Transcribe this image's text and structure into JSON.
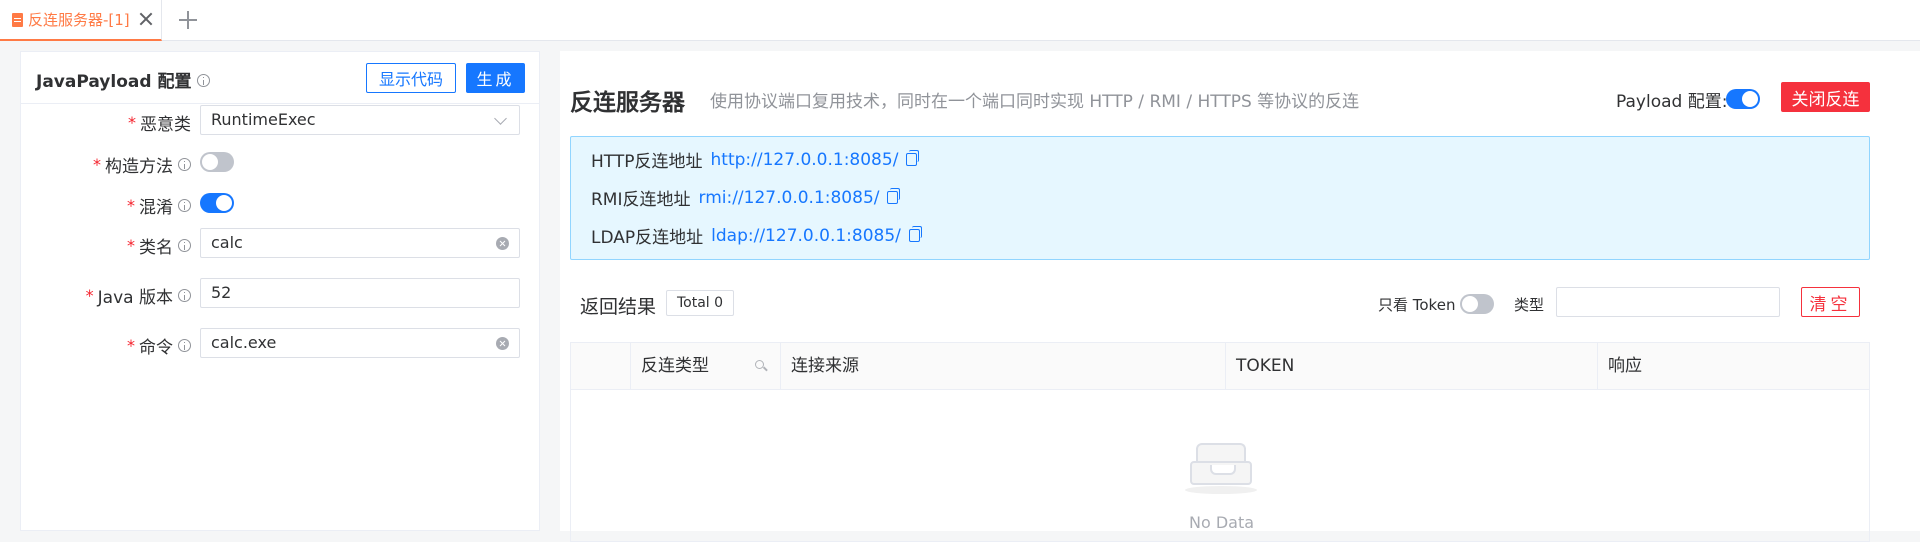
{
  "tabs": [
    {
      "label": "反连服务器-[1]",
      "active": true
    }
  ],
  "config": {
    "title": "JavaPayload 配置",
    "show_code_button": "显示代码",
    "generate_button": "生成",
    "fields": {
      "gadget": {
        "label": "恶意类",
        "value": "RuntimeExec"
      },
      "constructor": {
        "label": "构造方法",
        "enabled": false
      },
      "obfuscate": {
        "label": "混淆",
        "enabled": true
      },
      "class_name": {
        "label": "类名",
        "value": "calc"
      },
      "java_version": {
        "label": "Java 版本",
        "value": "52"
      },
      "command": {
        "label": "命令",
        "value": "calc.exe"
      }
    }
  },
  "server": {
    "title": "反连服务器",
    "subtitle": "使用协议端口复用技术，同时在一个端口同时实现 HTTP / RMI / HTTPS 等协议的反连",
    "payload_config_label": "Payload 配置:",
    "payload_config_enabled": true,
    "close_button": "关闭反连",
    "addresses": [
      {
        "label": "HTTP反连地址",
        "url": "http://127.0.0.1:8085/"
      },
      {
        "label": "RMI反连地址",
        "url": "rmi://127.0.0.1:8085/"
      },
      {
        "label": "LDAP反连地址",
        "url": "ldap://127.0.0.1:8085/"
      }
    ]
  },
  "results": {
    "title": "返回结果",
    "total": "Total 0",
    "token_only_label": "只看 Token",
    "token_only_enabled": false,
    "type_label": "类型",
    "type_value": "",
    "clear_button": "清空",
    "columns": [
      "反连类型",
      "连接来源",
      "TOKEN",
      "响应"
    ],
    "empty_text": "No Data"
  },
  "colors": {
    "accent": "#1677ff",
    "danger": "#f5313d",
    "tab_active": "#ff7a45",
    "info_bg": "#e6f7ff"
  }
}
